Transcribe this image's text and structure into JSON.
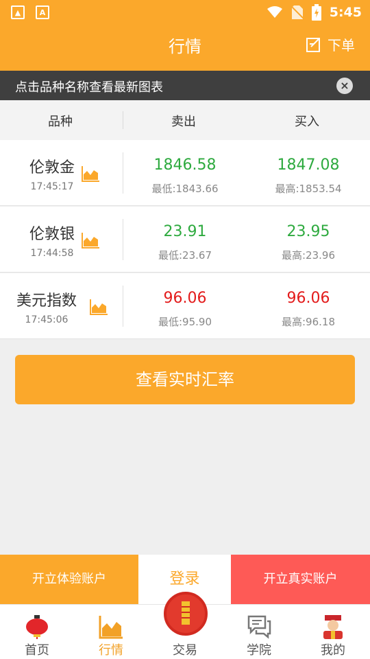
{
  "status": {
    "time": "5:45"
  },
  "header": {
    "title": "行情",
    "order_label": "下单"
  },
  "tip": {
    "text": "点击品种名称查看最新图表"
  },
  "table": {
    "columns": [
      "品种",
      "卖出",
      "买入"
    ],
    "rows": [
      {
        "name": "伦敦金",
        "time": "17:45:17",
        "sell": "1846.58",
        "buy": "1847.08",
        "low": "最低:1843.66",
        "high": "最高:1853.54",
        "color": "#2eaa3f"
      },
      {
        "name": "伦敦银",
        "time": "17:44:58",
        "sell": "23.91",
        "buy": "23.95",
        "low": "最低:23.67",
        "high": "最高:23.96",
        "color": "#2eaa3f"
      },
      {
        "name": "美元指数",
        "time": "17:45:06",
        "sell": "96.06",
        "buy": "96.06",
        "low": "最低:95.90",
        "high": "最高:96.18",
        "color": "#e31b1b"
      }
    ]
  },
  "rate_button": "查看实时汇率",
  "actions": {
    "trial": "开立体验账户",
    "login": "登录",
    "real": "开立真实账户"
  },
  "tabs": [
    {
      "label": "首页",
      "icon": "lantern-icon"
    },
    {
      "label": "行情",
      "icon": "chart-icon"
    },
    {
      "label": "交易",
      "icon": "firecracker-icon"
    },
    {
      "label": "学院",
      "icon": "chat-icon"
    },
    {
      "label": "我的",
      "icon": "fortune-god-icon"
    }
  ],
  "colors": {
    "accent": "#fba82b",
    "up": "#2eaa3f",
    "down": "#e31b1b",
    "real_account": "#fe5a56"
  }
}
